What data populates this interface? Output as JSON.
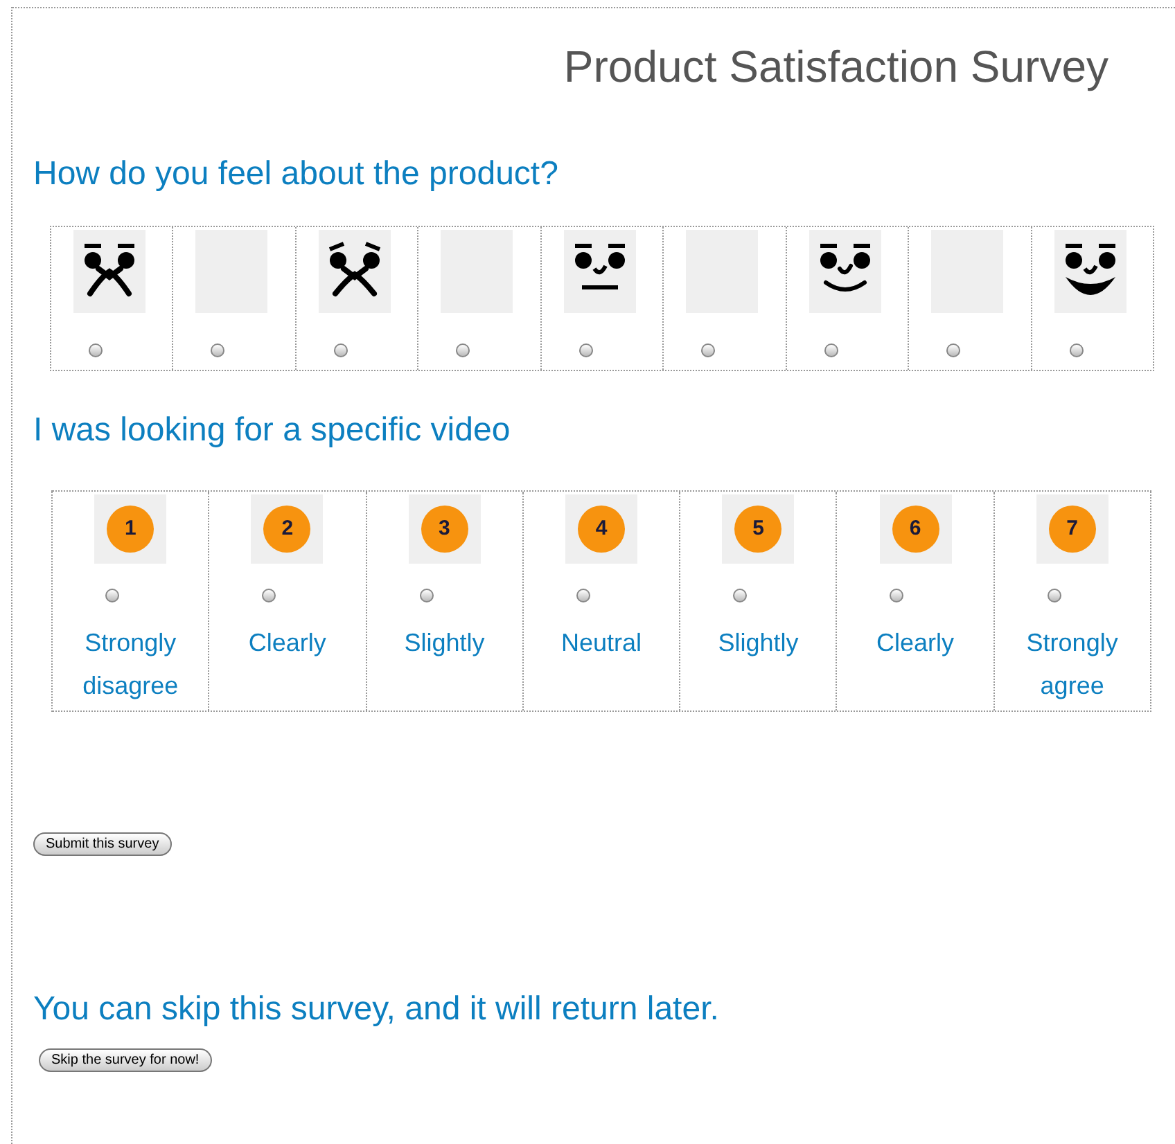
{
  "title": "Product Satisfaction Survey",
  "questions": [
    {
      "kind": "faces",
      "heading": "How do you feel about the product?",
      "options": [
        {
          "kind": "very-sad",
          "selected": false
        },
        {
          "kind": "blank",
          "selected": false
        },
        {
          "kind": "sad",
          "selected": false
        },
        {
          "kind": "blank",
          "selected": false
        },
        {
          "kind": "neutral",
          "selected": false
        },
        {
          "kind": "blank",
          "selected": false
        },
        {
          "kind": "happy",
          "selected": false
        },
        {
          "kind": "blank",
          "selected": false
        },
        {
          "kind": "very-happy",
          "selected": false
        }
      ]
    },
    {
      "kind": "numbers",
      "heading": "I was looking for a specific video",
      "options": [
        {
          "number": "1",
          "label": "Strongly disagree",
          "selected": false
        },
        {
          "number": "2",
          "label": "Clearly",
          "selected": false
        },
        {
          "number": "3",
          "label": "Slightly",
          "selected": false
        },
        {
          "number": "4",
          "label": "Neutral",
          "selected": false
        },
        {
          "number": "5",
          "label": "Slightly",
          "selected": false
        },
        {
          "number": "6",
          "label": "Clearly",
          "selected": false
        },
        {
          "number": "7",
          "label": "Strongly agree",
          "selected": false
        }
      ]
    }
  ],
  "submit_button": "Submit this survey",
  "skip_note": "You can skip this survey, and it will return later.",
  "skip_button": "Skip the survey for now!"
}
